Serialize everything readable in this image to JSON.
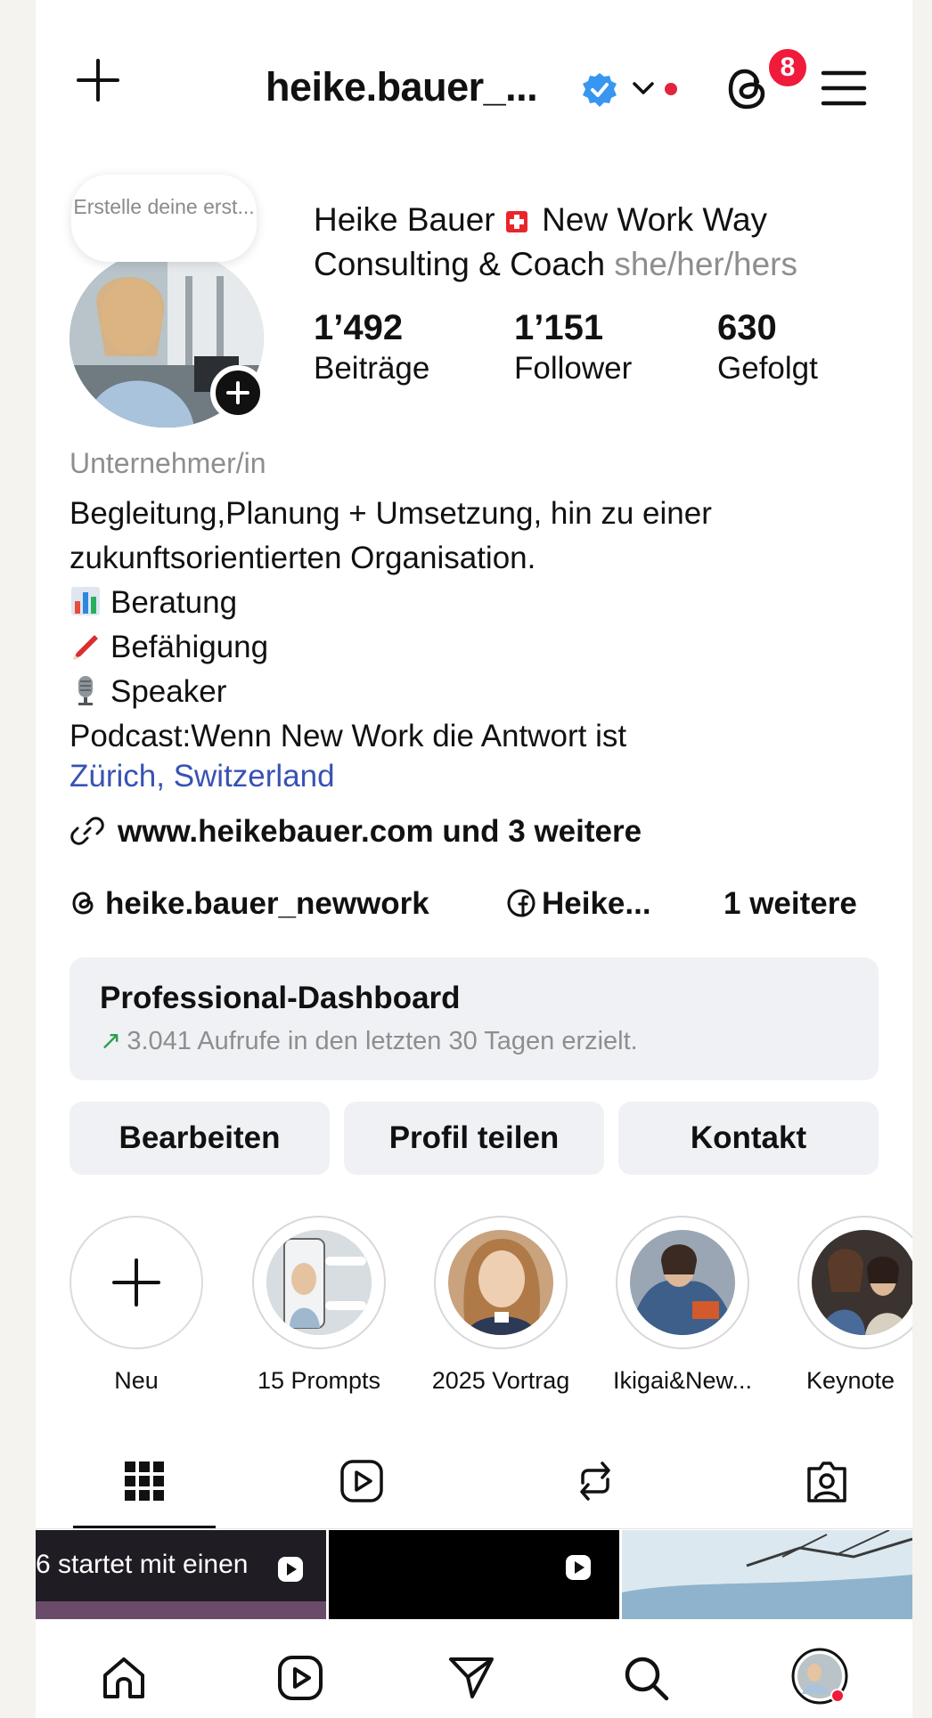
{
  "header": {
    "username": "heike.bauer_...",
    "notification_count": "8"
  },
  "profile": {
    "note_text": "Erstelle deine erst...",
    "name_line1": "Heike Bauer",
    "name_line1_rest": "New Work Way",
    "name_line2": "Consulting & Coach",
    "pronouns": "she/her/hers",
    "stats": [
      {
        "value": "1’492",
        "label": "Beiträge"
      },
      {
        "value": "1’151",
        "label": "Follower"
      },
      {
        "value": "630",
        "label": "Gefolgt"
      }
    ],
    "category": "Unternehmer/in",
    "bio": {
      "line1": "Begleitung,Planung + Umsetzung, hin zu einer",
      "line2": "zukunftsorientierten Organisation.",
      "item1": "Beratung",
      "item2": "Befähigung",
      "item3": "Speaker",
      "line6": "Podcast:Wenn New Work die Antwort ist"
    },
    "location": "Zürich, Switzerland",
    "link": "www.heikebauer.com und 3 weitere",
    "threads_handle": "heike.bauer_newwork",
    "facebook_name": "Heike...",
    "more_links": "1 weitere"
  },
  "dashboard": {
    "title": "Professional-Dashboard",
    "subtitle": "3.041 Aufrufe in den letzten 30 Tagen erzielt."
  },
  "actions": {
    "edit": "Bearbeiten",
    "share": "Profil teilen",
    "contact": "Kontakt"
  },
  "highlights": [
    {
      "label": "Neu"
    },
    {
      "label": "15 Prompts"
    },
    {
      "label": "2025 Vortrag"
    },
    {
      "label": "Ikigai&New..."
    },
    {
      "label": "Keynote"
    }
  ],
  "grid": {
    "post1_caption": "6 startet mit einen"
  },
  "colors": {
    "accent_blue": "#3852b4",
    "badge_red": "#f01a3a",
    "verified_blue": "#3797f0",
    "button_bg": "#eff1f4"
  }
}
